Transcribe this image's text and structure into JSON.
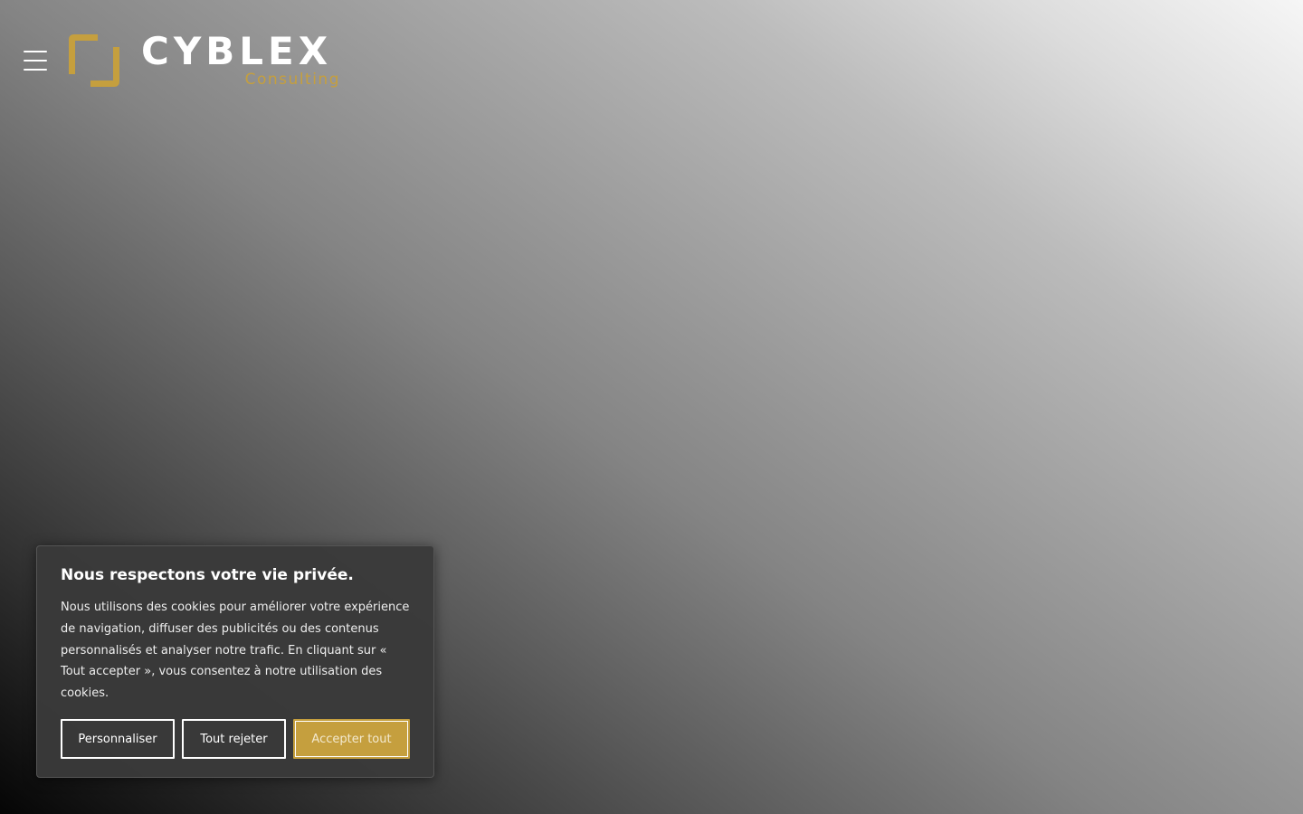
{
  "header": {
    "logo": {
      "wordmark": "CYBLEX",
      "tagline": "Consulting"
    },
    "menu_icon": "hamburger-menu-icon"
  },
  "cookie_banner": {
    "title": "Nous respectons votre vie privée.",
    "message": "Nous utilisons des cookies pour améliorer votre expérience de navigation, diffuser des publicités ou des contenus personnalisés et analyser notre trafic. En cliquant sur « Tout accepter », vous consentez à notre utilisation des cookies.",
    "buttons": {
      "customize": "Personnaliser",
      "reject": "Tout rejeter",
      "accept": "Accepter tout"
    }
  },
  "colors": {
    "accent": "#c59f3e",
    "banner_background": "#3a3a3a",
    "text": "#ffffff"
  }
}
